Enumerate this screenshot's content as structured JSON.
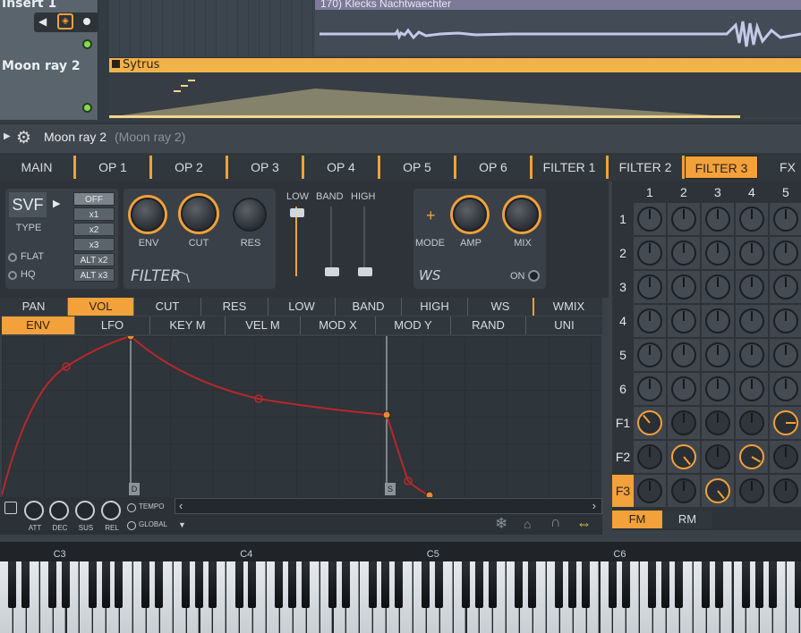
{
  "playlist": {
    "tracks": [
      {
        "name": "Insert 1"
      },
      {
        "name": "Moon ray 2"
      }
    ],
    "audio_clip": "170) Klecks Nachtwaechter",
    "pattern_clip": "Sytrus"
  },
  "channel": {
    "title": "Moon ray 2",
    "subtitle": "(Moon ray 2)"
  },
  "tabs": [
    "MAIN",
    "OP 1",
    "OP 2",
    "OP 3",
    "OP 4",
    "OP 5",
    "OP 6",
    "FILTER 1",
    "FILTER 2",
    "FILTER 3",
    "FX"
  ],
  "filter": {
    "type_value": "SVF",
    "type_label": "TYPE",
    "multipliers": [
      "OFF",
      "x1",
      "x2",
      "x3",
      "ALT x2",
      "ALT x3"
    ],
    "flat_label": "FLAT",
    "hq_label": "HQ",
    "knobs": [
      "ENV",
      "CUT",
      "RES"
    ],
    "filter_logo": "FILTER",
    "eq_labels": [
      "LOW",
      "BAND",
      "HIGH"
    ],
    "ws": {
      "mode": "MODE",
      "amp": "AMP",
      "mix": "MIX",
      "on": "ON",
      "logo": "WS"
    }
  },
  "target_tabs": [
    "PAN",
    "VOL",
    "CUT",
    "RES",
    "LOW",
    "BAND",
    "HIGH",
    "WS",
    "WMIX"
  ],
  "mod_tabs": [
    "ENV",
    "LFO",
    "KEY M",
    "VEL M",
    "MOD X",
    "MOD Y",
    "RAND",
    "UNI"
  ],
  "envelope": {
    "markers": [
      "D",
      "S"
    ],
    "adsr_labels": [
      "ATT",
      "DEC",
      "SUS",
      "REL"
    ],
    "tempo_label": "TEMPO",
    "global_label": "GLOBAL"
  },
  "matrix": {
    "columns": [
      "1",
      "2",
      "3",
      "4",
      "5"
    ],
    "rows": [
      "1",
      "2",
      "3",
      "4",
      "5",
      "6",
      "F1",
      "F2",
      "F3"
    ],
    "bottom_tabs": [
      "FM",
      "RM"
    ]
  },
  "piano": {
    "octave_labels": [
      "C3",
      "C4",
      "C5",
      "C6"
    ]
  },
  "colors": {
    "accent": "#f3a13a",
    "envelope_curve": "#b8282a",
    "clip": "#f2b24a"
  }
}
